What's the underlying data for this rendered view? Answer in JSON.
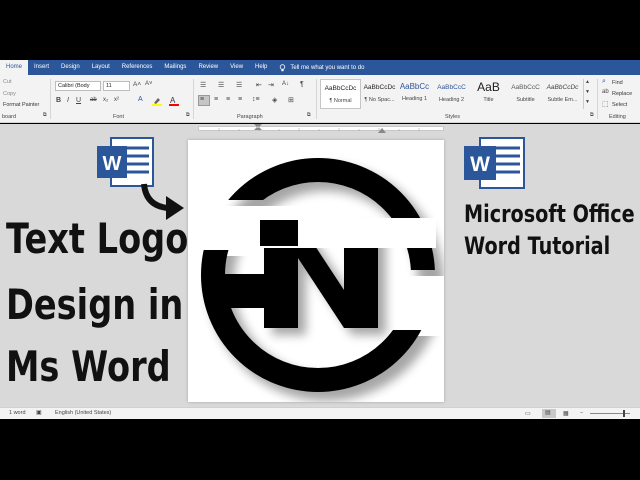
{
  "ribbon_tabs": {
    "home": "Home",
    "insert": "Insert",
    "design": "Design",
    "layout": "Layout",
    "references": "References",
    "mailings": "Mailings",
    "review": "Review",
    "view": "View",
    "help": "Help",
    "tell_me": "Tell me what you want to do"
  },
  "clipboard": {
    "cut": "Cut",
    "copy": "Copy",
    "format_painter": "Format Painter",
    "label": "board"
  },
  "font": {
    "name": "Calibri (Body",
    "size": "11",
    "label": "Font"
  },
  "paragraph": {
    "label": "Paragraph"
  },
  "styles": {
    "label": "Styles",
    "items": [
      {
        "preview": "AaBbCcDc",
        "name": "¶ Normal"
      },
      {
        "preview": "AaBbCcDc",
        "name": "¶ No Spac..."
      },
      {
        "preview": "AaBbCc",
        "name": "Heading 1"
      },
      {
        "preview": "AaBbCcC",
        "name": "Heading 2"
      },
      {
        "preview": "AaB",
        "name": "Title"
      },
      {
        "preview": "AaBbCcC",
        "name": "Subtitle"
      },
      {
        "preview": "AaBbCcDc",
        "name": "Subtle Em..."
      }
    ]
  },
  "editing": {
    "find": "Find",
    "replace": "Replace",
    "select": "Select",
    "label": "Editing"
  },
  "overlay": {
    "line1": "Text Logo",
    "line2": "Design in",
    "line3": "Ms Word",
    "tutorial_line1": "Microsoft Office",
    "tutorial_line2": "Word Tutorial"
  },
  "word_icon_letter": "W",
  "status_bar": {
    "word_count": "1 word",
    "language": "English (United States)"
  },
  "colors": {
    "ribbon_blue": "#2b579a",
    "word_blue": "#2b579a",
    "highlight_yellow": "#ffff00",
    "font_color_red": "#ff0000"
  }
}
